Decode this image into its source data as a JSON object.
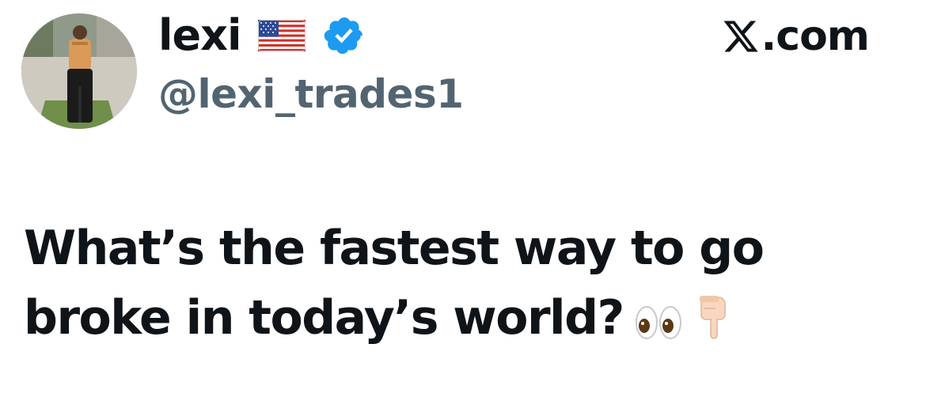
{
  "author": {
    "display_name": "lexi",
    "handle": "@lexi_trades1",
    "flag_icon": "us-flag-icon",
    "verified_icon": "verified-badge-icon",
    "verified_color": "#1d9bf0"
  },
  "brand": {
    "label": ".com",
    "logo_icon": "x-logo-icon"
  },
  "tweet": {
    "line1": "What’s the fastest way to go",
    "line2": "broke in today’s world?",
    "emojis": [
      "eyes-emoji",
      "backhand-index-pointing-down-emoji"
    ]
  },
  "colors": {
    "text": "#0f1419",
    "secondary": "#536471",
    "background": "#ffffff"
  }
}
